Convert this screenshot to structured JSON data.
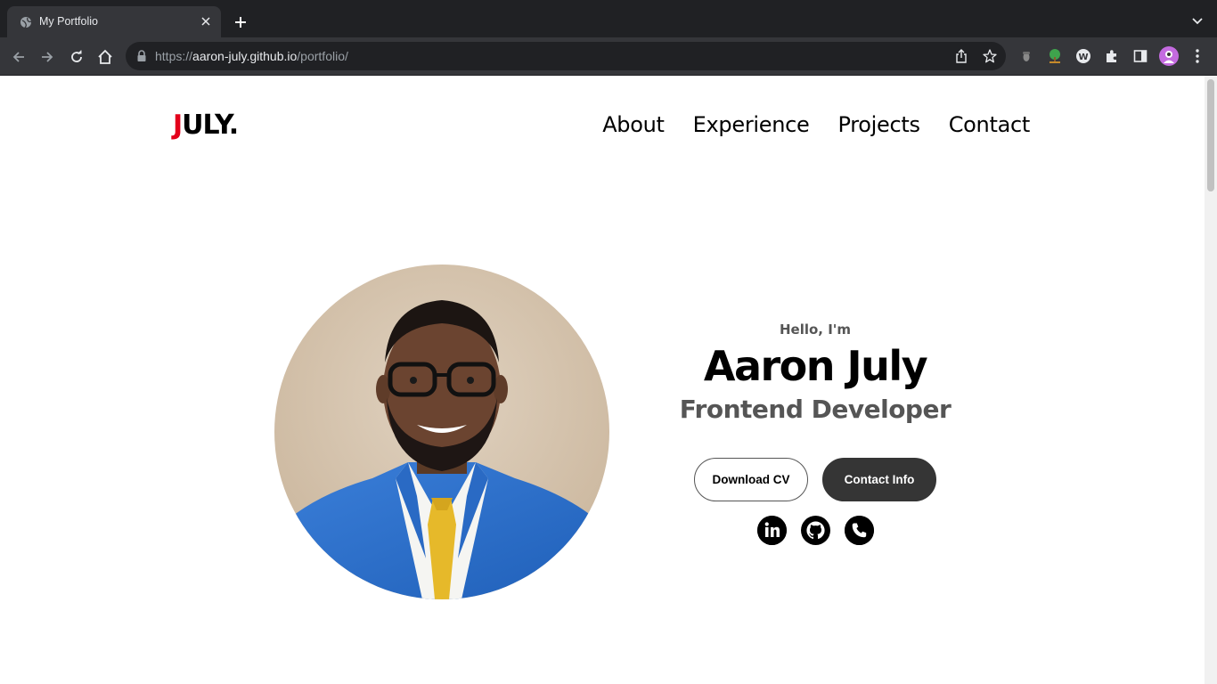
{
  "browser": {
    "tab_title": "My Portfolio",
    "url_scheme": "https://",
    "url_host": "aaron-july.github.io",
    "url_path": "/portfolio/"
  },
  "icons": {
    "tab_favicon": "globe-icon",
    "tab_close": "close-icon",
    "new_tab": "plus-icon",
    "tab_search": "chevron-down-icon",
    "back": "back-arrow-icon",
    "forward": "forward-arrow-icon",
    "reload": "reload-icon",
    "home": "home-icon",
    "lock": "lock-icon",
    "share": "share-icon",
    "bookmark": "star-icon",
    "extensions": "puzzle-icon",
    "side_panel": "side-panel-icon",
    "menu": "kebab-menu-icon",
    "linkedin": "linkedin-icon",
    "github": "github-icon",
    "phone": "phone-icon"
  },
  "header": {
    "logo_first": "J",
    "logo_rest": "ULY.",
    "nav": [
      {
        "label": "About"
      },
      {
        "label": "Experience"
      },
      {
        "label": "Projects"
      },
      {
        "label": "Contact"
      }
    ]
  },
  "hero": {
    "greeting": "Hello, I'm",
    "name": "Aaron July",
    "role": "Frontend Developer",
    "download_cv": "Download CV",
    "contact_info": "Contact Info"
  },
  "colors": {
    "accent": "#e3001b",
    "dark_button": "#353535",
    "chrome_dark": "#202124",
    "chrome_toolbar": "#35363a"
  }
}
